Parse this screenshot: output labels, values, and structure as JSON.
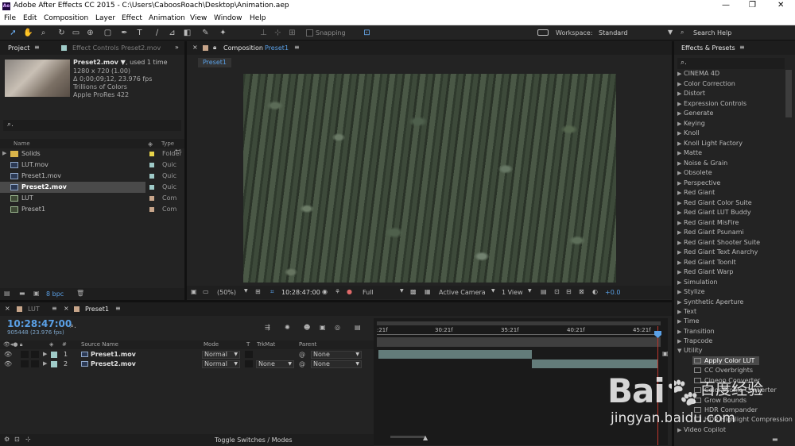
{
  "window": {
    "title": "Adobe After Effects CC 2015 - C:\\Users\\CaboosRoach\\Desktop\\Animation.aep",
    "logo": "Ae"
  },
  "menu": [
    "File",
    "Edit",
    "Composition",
    "Layer",
    "Effect",
    "Animation",
    "View",
    "Window",
    "Help"
  ],
  "toolbar": {
    "snapping": "Snapping",
    "workspace_label": "Workspace:",
    "workspace_value": "Standard",
    "search_help": "Search Help"
  },
  "project": {
    "tab": "Project",
    "effect_controls_tab": "Effect Controls Preset2.mov",
    "item_name": "Preset2.mov ▼",
    "item_used": ", used 1 time",
    "item_info": [
      "1280 x 720 (1.00)",
      "Δ 0;00;09;12, 23.976 fps",
      "Trillions of Colors",
      "Apple ProRes 422"
    ],
    "col_name": "Name",
    "col_type": "Type",
    "items": [
      {
        "name": "Solids",
        "type": "Folder",
        "kind": "folder",
        "color": "#e8d44a"
      },
      {
        "name": "LUT.mov",
        "type": "Quic",
        "kind": "footage",
        "color": "#9fcbc8"
      },
      {
        "name": "Preset1.mov",
        "type": "Quic",
        "kind": "footage",
        "color": "#9fcbc8"
      },
      {
        "name": "Preset2.mov",
        "type": "Quic",
        "kind": "footage",
        "color": "#9fcbc8",
        "selected": true
      },
      {
        "name": "LUT",
        "type": "Com",
        "kind": "comp",
        "color": "#c7a58a"
      },
      {
        "name": "Preset1",
        "type": "Com",
        "kind": "comp",
        "color": "#c7a58a"
      }
    ],
    "bpc": "8 bpc"
  },
  "composition": {
    "panel_label": "Composition",
    "comp_name": "Preset1",
    "tab": "Preset1",
    "zoom": "(50%)",
    "timecode": "10:28:47:00",
    "resolution": "Full",
    "camera": "Active Camera",
    "views": "1 View",
    "exposure": "+0.0"
  },
  "effects": {
    "title": "Effects & Presets",
    "categories": [
      "CINEMA 4D",
      "Color Correction",
      "Distort",
      "Expression Controls",
      "Generate",
      "Keying",
      "Knoll",
      "Knoll Light Factory",
      "Matte",
      "Noise & Grain",
      "Obsolete",
      "Perspective",
      "Red Giant",
      "Red Giant Color Suite",
      "Red Giant LUT Buddy",
      "Red Giant MisFire",
      "Red Giant Psunami",
      "Red Giant Shooter Suite",
      "Red Giant Text Anarchy",
      "Red Giant ToonIt",
      "Red Giant Warp",
      "Simulation",
      "Stylize",
      "Synthetic Aperture",
      "Text",
      "Time",
      "Transition",
      "Trapcode",
      "Utility"
    ],
    "utility_items": [
      "Apply Color LUT",
      "CC Overbrights",
      "Cineon Converter",
      "Color Profile Converter",
      "Grow Bounds",
      "HDR Compander",
      "HDR Highlight Compression"
    ],
    "last": "Video Copilot"
  },
  "timeline": {
    "tabs": [
      "LUT",
      "Preset1"
    ],
    "timecode": "10:28:47:00",
    "frames": "905448 (23.976 fps)",
    "headers": {
      "num": "#",
      "source": "Source Name",
      "mode": "Mode",
      "t": "T",
      "trkmat": "TrkMat",
      "parent": "Parent"
    },
    "layers": [
      {
        "num": "1",
        "name": "Preset1.mov",
        "mode": "Normal",
        "trkmat": "",
        "parent": "None"
      },
      {
        "num": "2",
        "name": "Preset2.mov",
        "mode": "Normal",
        "trkmat": "None",
        "parent": "None"
      }
    ],
    "ruler": [
      ":21f",
      "30:21f",
      "35:21f",
      "40:21f",
      "45:21f"
    ],
    "toggle": "Toggle Switches / Modes"
  },
  "watermark": {
    "text1": "Bai",
    "text2": "百度经验",
    "url": "jingyan.baidu.com"
  }
}
